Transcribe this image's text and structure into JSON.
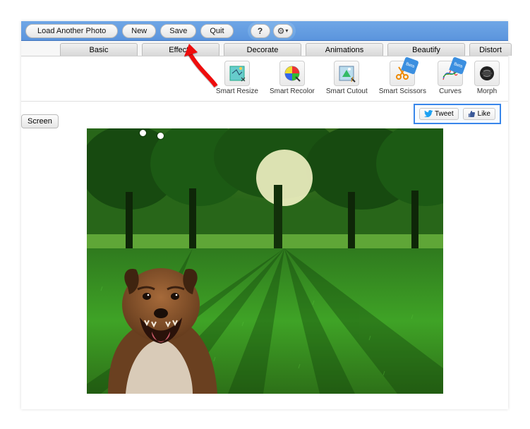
{
  "topbar": {
    "load_label": "Load Another Photo",
    "new_label": "New",
    "save_label": "Save",
    "quit_label": "Quit",
    "help_label": "?",
    "gear_label": "⚙"
  },
  "tabs": {
    "basic": "Basic",
    "effects": "Effects",
    "decorate": "Decorate",
    "animations": "Animations",
    "beautify": "Beautify",
    "distort": "Distort"
  },
  "tools": {
    "smart_resize": "Smart Resize",
    "smart_recolor": "Smart Recolor",
    "smart_cutout": "Smart Cutout",
    "smart_scissors": "Smart Scissors",
    "curves": "Curves",
    "morph": "Morph",
    "beta_badge": "Beta"
  },
  "subbar": {
    "screen": "Screen",
    "tweet": "Tweet",
    "like": "Like"
  },
  "canvas": {
    "description": "park-with-dog-composite"
  }
}
